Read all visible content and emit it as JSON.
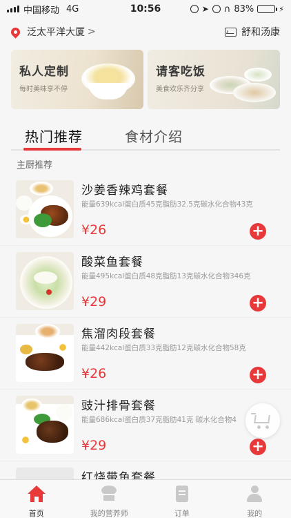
{
  "status_bar": {
    "carrier": "中国移动",
    "network": "4G",
    "time": "10:56",
    "battery": "83%",
    "battery_level": 0.83
  },
  "location_bar": {
    "address": "泛太平洋大厦",
    "address_chevron": ">",
    "shop_name": "舒和汤康"
  },
  "banners": [
    {
      "title": "私人定制",
      "subtitle": "每时美味享不停"
    },
    {
      "title": "请客吃饭",
      "subtitle": "美食欢乐齐分享"
    }
  ],
  "tabs": [
    {
      "label": "热门推荐",
      "active": true
    },
    {
      "label": "食材介绍",
      "active": false
    }
  ],
  "section_title": "主厨推荐",
  "food_items": [
    {
      "name": "沙姜香辣鸡套餐",
      "desc": "能量639kcal蛋白质45克脂肪32.5克碳水化合物43克",
      "price": "¥26",
      "add_label": "+"
    },
    {
      "name": "酸菜鱼套餐",
      "desc": "能量495kcal蛋白质48克脂肪13克碳水化合物346克",
      "price": "¥29",
      "add_label": "+"
    },
    {
      "name": "焦溜肉段套餐",
      "desc": "能量442kcal蛋白质33克脂肪12克碳水化合物58克",
      "price": "¥26",
      "add_label": "+"
    },
    {
      "name": "豉汁排骨套餐",
      "desc": "能量686kcal蛋白质37克脂肪41克 碳水化合物4",
      "price": "¥29",
      "add_label": "+"
    },
    {
      "name": "红烧带鱼套餐",
      "desc": "",
      "price": "",
      "add_label": ""
    }
  ],
  "tabbar": [
    {
      "label": "首页",
      "icon": "home-icon",
      "active": true
    },
    {
      "label": "我的营养师",
      "icon": "chef-icon",
      "active": false
    },
    {
      "label": "订单",
      "icon": "order-icon",
      "active": false
    },
    {
      "label": "我的",
      "icon": "user-icon",
      "active": false
    }
  ],
  "colors": {
    "accent": "#e8393a",
    "background": "#f6f6f6",
    "muted_text": "#999999",
    "battery_green": "#3cc33c"
  }
}
